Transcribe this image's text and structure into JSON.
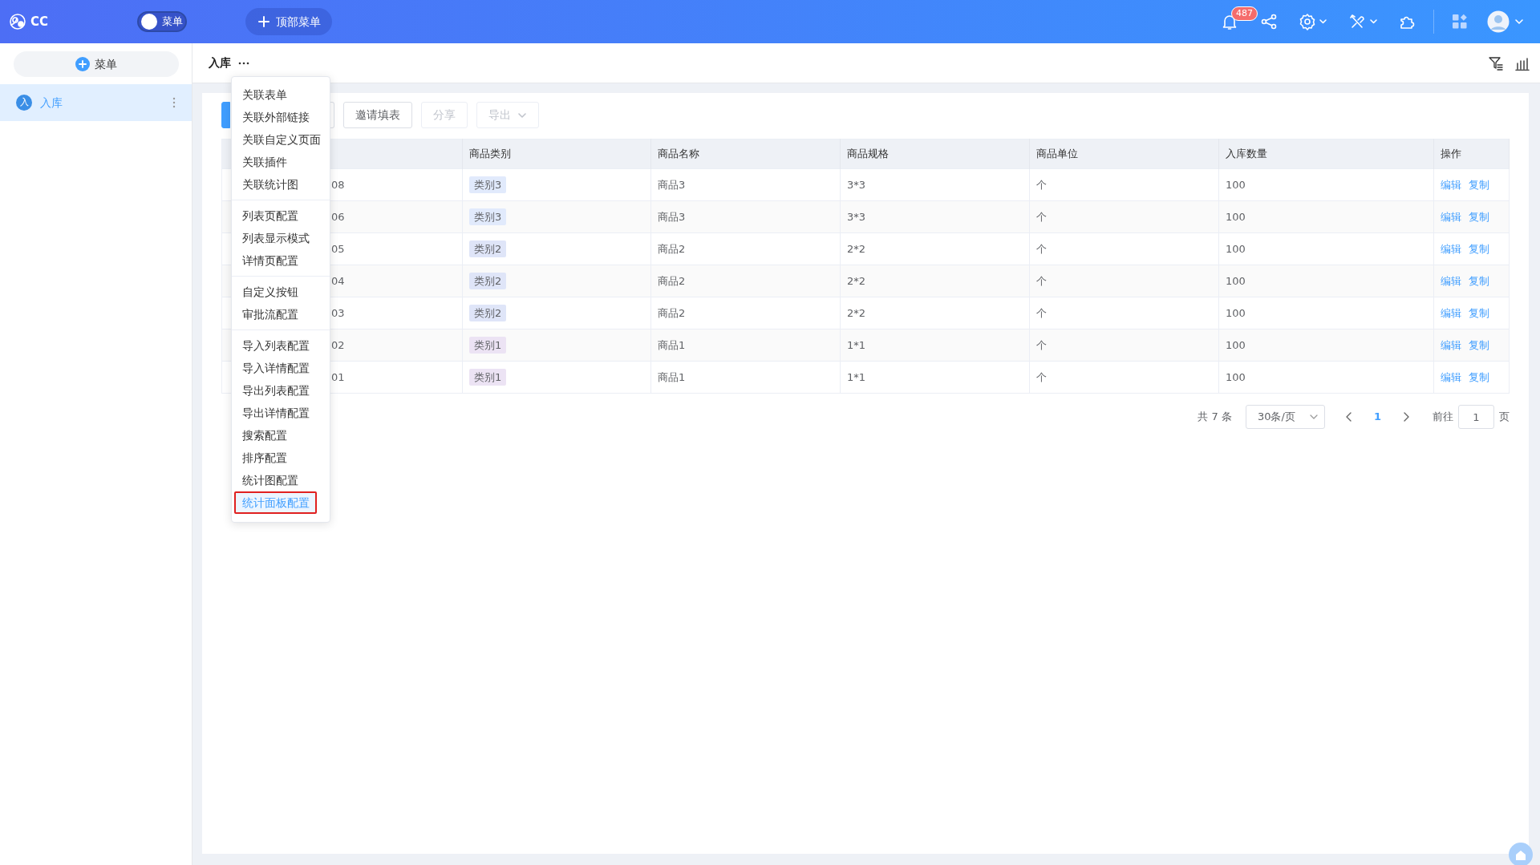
{
  "topbar": {
    "brand": "CC",
    "menu_switch": {
      "label": "菜单",
      "on": false
    },
    "top_menu_button": "顶部菜单",
    "notification_count": "487"
  },
  "sidebar": {
    "add_button": "菜单",
    "items": [
      {
        "avatar": "入",
        "label": "入库",
        "selected": true
      }
    ]
  },
  "page": {
    "title": "入库"
  },
  "toolbar": {
    "buttons": [
      {
        "kind": "primary",
        "disabled": false
      },
      {
        "kind": "default",
        "disabled": false
      },
      {
        "kind": "default",
        "label": "邀请填表",
        "disabled": false
      },
      {
        "kind": "default",
        "label": "分享",
        "disabled": true
      },
      {
        "kind": "dropdown",
        "label": "导出",
        "disabled": true
      }
    ]
  },
  "table": {
    "columns": [
      "商品类别",
      "商品名称",
      "商品规格",
      "商品单位",
      "入库数量",
      "操作"
    ],
    "rows": [
      {
        "column_1": "08",
        "category": {
          "text": "类别3",
          "color": "#e1eafc"
        },
        "name": "商品3",
        "spec": "3*3",
        "unit": "个",
        "quantity": "100",
        "actions": [
          "编辑",
          "复制"
        ]
      },
      {
        "column_1": "06",
        "category": {
          "text": "类别3",
          "color": "#e1eafc"
        },
        "name": "商品3",
        "spec": "3*3",
        "unit": "个",
        "quantity": "100",
        "actions": [
          "编辑",
          "复制"
        ]
      },
      {
        "column_1": "05",
        "category": {
          "text": "类别2",
          "color": "#dfe5f8"
        },
        "name": "商品2",
        "spec": "2*2",
        "unit": "个",
        "quantity": "100",
        "actions": [
          "编辑",
          "复制"
        ]
      },
      {
        "column_1": "04",
        "category": {
          "text": "类别2",
          "color": "#dfe5f8"
        },
        "name": "商品2",
        "spec": "2*2",
        "unit": "个",
        "quantity": "100",
        "actions": [
          "编辑",
          "复制"
        ]
      },
      {
        "column_1": "03",
        "category": {
          "text": "类别2",
          "color": "#dfe5f8"
        },
        "name": "商品2",
        "spec": "2*2",
        "unit": "个",
        "quantity": "100",
        "actions": [
          "编辑",
          "复制"
        ]
      },
      {
        "column_1": "02",
        "category": {
          "text": "类别1",
          "color": "#ece3f4"
        },
        "name": "商品1",
        "spec": "1*1",
        "unit": "个",
        "quantity": "100",
        "actions": [
          "编辑",
          "复制"
        ]
      },
      {
        "column_1": "01",
        "category": {
          "text": "类别1",
          "color": "#ece3f4"
        },
        "name": "商品1",
        "spec": "1*1",
        "unit": "个",
        "quantity": "100",
        "actions": [
          "编辑",
          "复制"
        ]
      }
    ]
  },
  "pagination": {
    "total": "共 7 条",
    "page_size": "30条/页",
    "current": "1",
    "goto_label": "前往",
    "goto_value": "1",
    "page_suffix": "页"
  },
  "context_menu": {
    "groups": [
      [
        {
          "label": "关联表单",
          "selected": false,
          "outlined": false
        },
        {
          "label": "关联外部链接",
          "selected": false,
          "outlined": false
        },
        {
          "label": "关联自定义页面",
          "selected": false,
          "outlined": false
        },
        {
          "label": "关联插件",
          "selected": false,
          "outlined": false
        },
        {
          "label": "关联统计图",
          "selected": false,
          "outlined": false
        }
      ],
      [
        {
          "label": "列表页配置",
          "selected": false,
          "outlined": false
        },
        {
          "label": "列表显示模式",
          "selected": false,
          "outlined": false
        },
        {
          "label": "详情页配置",
          "selected": false,
          "outlined": false
        }
      ],
      [
        {
          "label": "自定义按钮",
          "selected": false,
          "outlined": false
        },
        {
          "label": "审批流配置",
          "selected": false,
          "outlined": false
        }
      ],
      [
        {
          "label": "导入列表配置",
          "selected": false,
          "outlined": false
        },
        {
          "label": "导入详情配置",
          "selected": false,
          "outlined": false
        },
        {
          "label": "导出列表配置",
          "selected": false,
          "outlined": false
        },
        {
          "label": "导出详情配置",
          "selected": false,
          "outlined": false
        },
        {
          "label": "搜索配置",
          "selected": false,
          "outlined": false
        },
        {
          "label": "排序配置",
          "selected": false,
          "outlined": false
        },
        {
          "label": "统计图配置",
          "selected": false,
          "outlined": false
        },
        {
          "label": "统计面板配置",
          "selected": true,
          "outlined": true
        }
      ]
    ]
  }
}
